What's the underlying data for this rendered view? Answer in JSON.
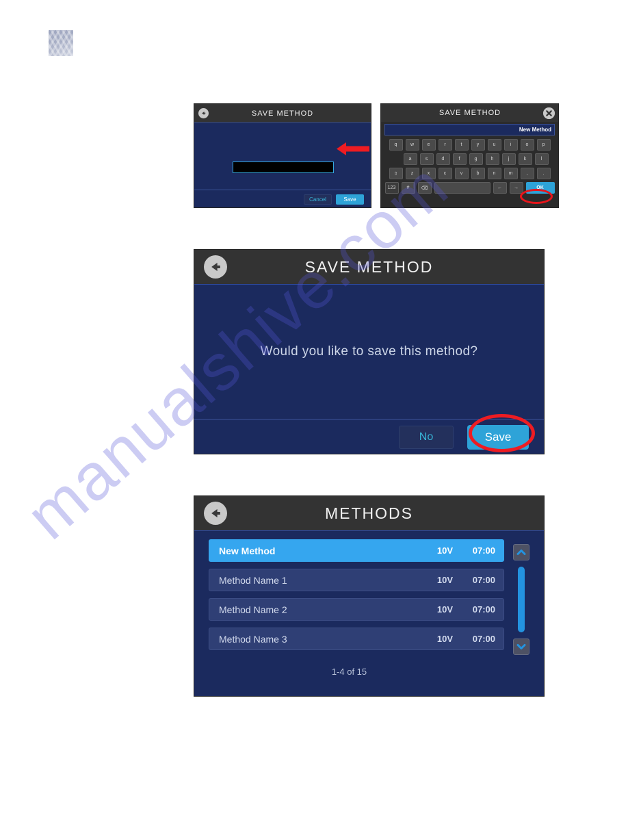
{
  "watermark": {
    "text": "manualshive.com"
  },
  "logo": {
    "name": "company-logo"
  },
  "panel_save_small": {
    "title": "SAVE METHOD",
    "back_icon": "back-arrow-icon",
    "input_value": "",
    "cancel_label": "Cancel",
    "save_label": "Save"
  },
  "annotations": {
    "red_arrow": "red-arrow-pointing-left",
    "red_ellipse_ok": "red-ellipse-highlight-ok",
    "red_ellipse_save": "red-ellipse-highlight-save"
  },
  "panel_keyboard": {
    "title": "SAVE METHOD",
    "close_icon": "close-x-icon",
    "field_value": "New Method",
    "rows": [
      [
        "q",
        "w",
        "e",
        "r",
        "t",
        "y",
        "u",
        "i",
        "o",
        "p"
      ],
      [
        "a",
        "s",
        "d",
        "f",
        "g",
        "h",
        "j",
        "k",
        "l"
      ],
      [
        "⇧",
        "z",
        "x",
        "c",
        "v",
        "b",
        "n",
        "m",
        ",",
        "."
      ],
      [
        "123",
        "#",
        "⌫",
        "",
        "←",
        "→",
        "OK"
      ]
    ],
    "ok_label": "OK",
    "shift_label": "⇧",
    "backspace_label": "⌫",
    "numbers_label": "123",
    "symbols_label": "#",
    "arrow_left_label": "←",
    "arrow_right_label": "→"
  },
  "panel_save_big": {
    "title": "SAVE METHOD",
    "back_icon": "back-arrow-icon",
    "question": "Would you like to save this method?",
    "no_label": "No",
    "save_label": "Save"
  },
  "panel_methods": {
    "title": "METHODS",
    "back_icon": "back-arrow-icon",
    "pager": "1-4 of 15",
    "scroll_up_icon": "chevron-up-icon",
    "scroll_down_icon": "chevron-down-icon",
    "rows": [
      {
        "name": "New Method",
        "voltage": "10V",
        "time": "07:00",
        "selected": true
      },
      {
        "name": "Method Name 1",
        "voltage": "10V",
        "time": "07:00",
        "selected": false
      },
      {
        "name": "Method Name 2",
        "voltage": "10V",
        "time": "07:00",
        "selected": false
      },
      {
        "name": "Method Name 3",
        "voltage": "10V",
        "time": "07:00",
        "selected": false
      }
    ]
  },
  "colors": {
    "panel_blue": "#1b2a5e",
    "titlebar_gray": "#333333",
    "accent_cyan": "#2ea3d8",
    "selected_row": "#35a6ef",
    "annotation_red": "#ee1c22"
  }
}
